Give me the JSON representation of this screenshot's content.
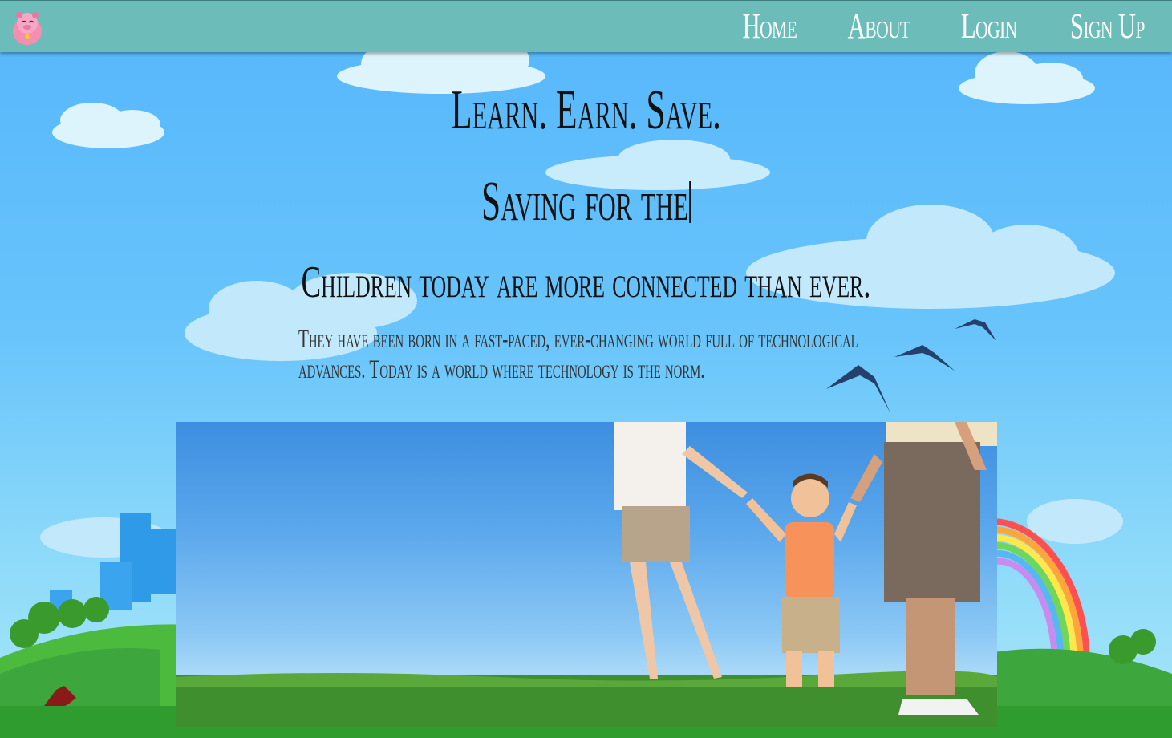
{
  "nav": {
    "logo_icon": "piggy-bank-icon",
    "links": [
      "Home",
      "About",
      "Login",
      "Sign Up"
    ]
  },
  "hero": {
    "title": "Learn. Earn. Save.",
    "subtitle": "Saving for the",
    "heading": "Children today are more connected than ever.",
    "text": "They have been born in a fast-paced, ever-changing world full of technological advances. Today is a world where technology is the norm."
  },
  "photo": {
    "subject": "family-walking-photo"
  },
  "colors": {
    "navbar": "#6cbcba",
    "sky": "#55b6fb",
    "grass": "#3da63d",
    "nav_text": "#ffffff"
  }
}
